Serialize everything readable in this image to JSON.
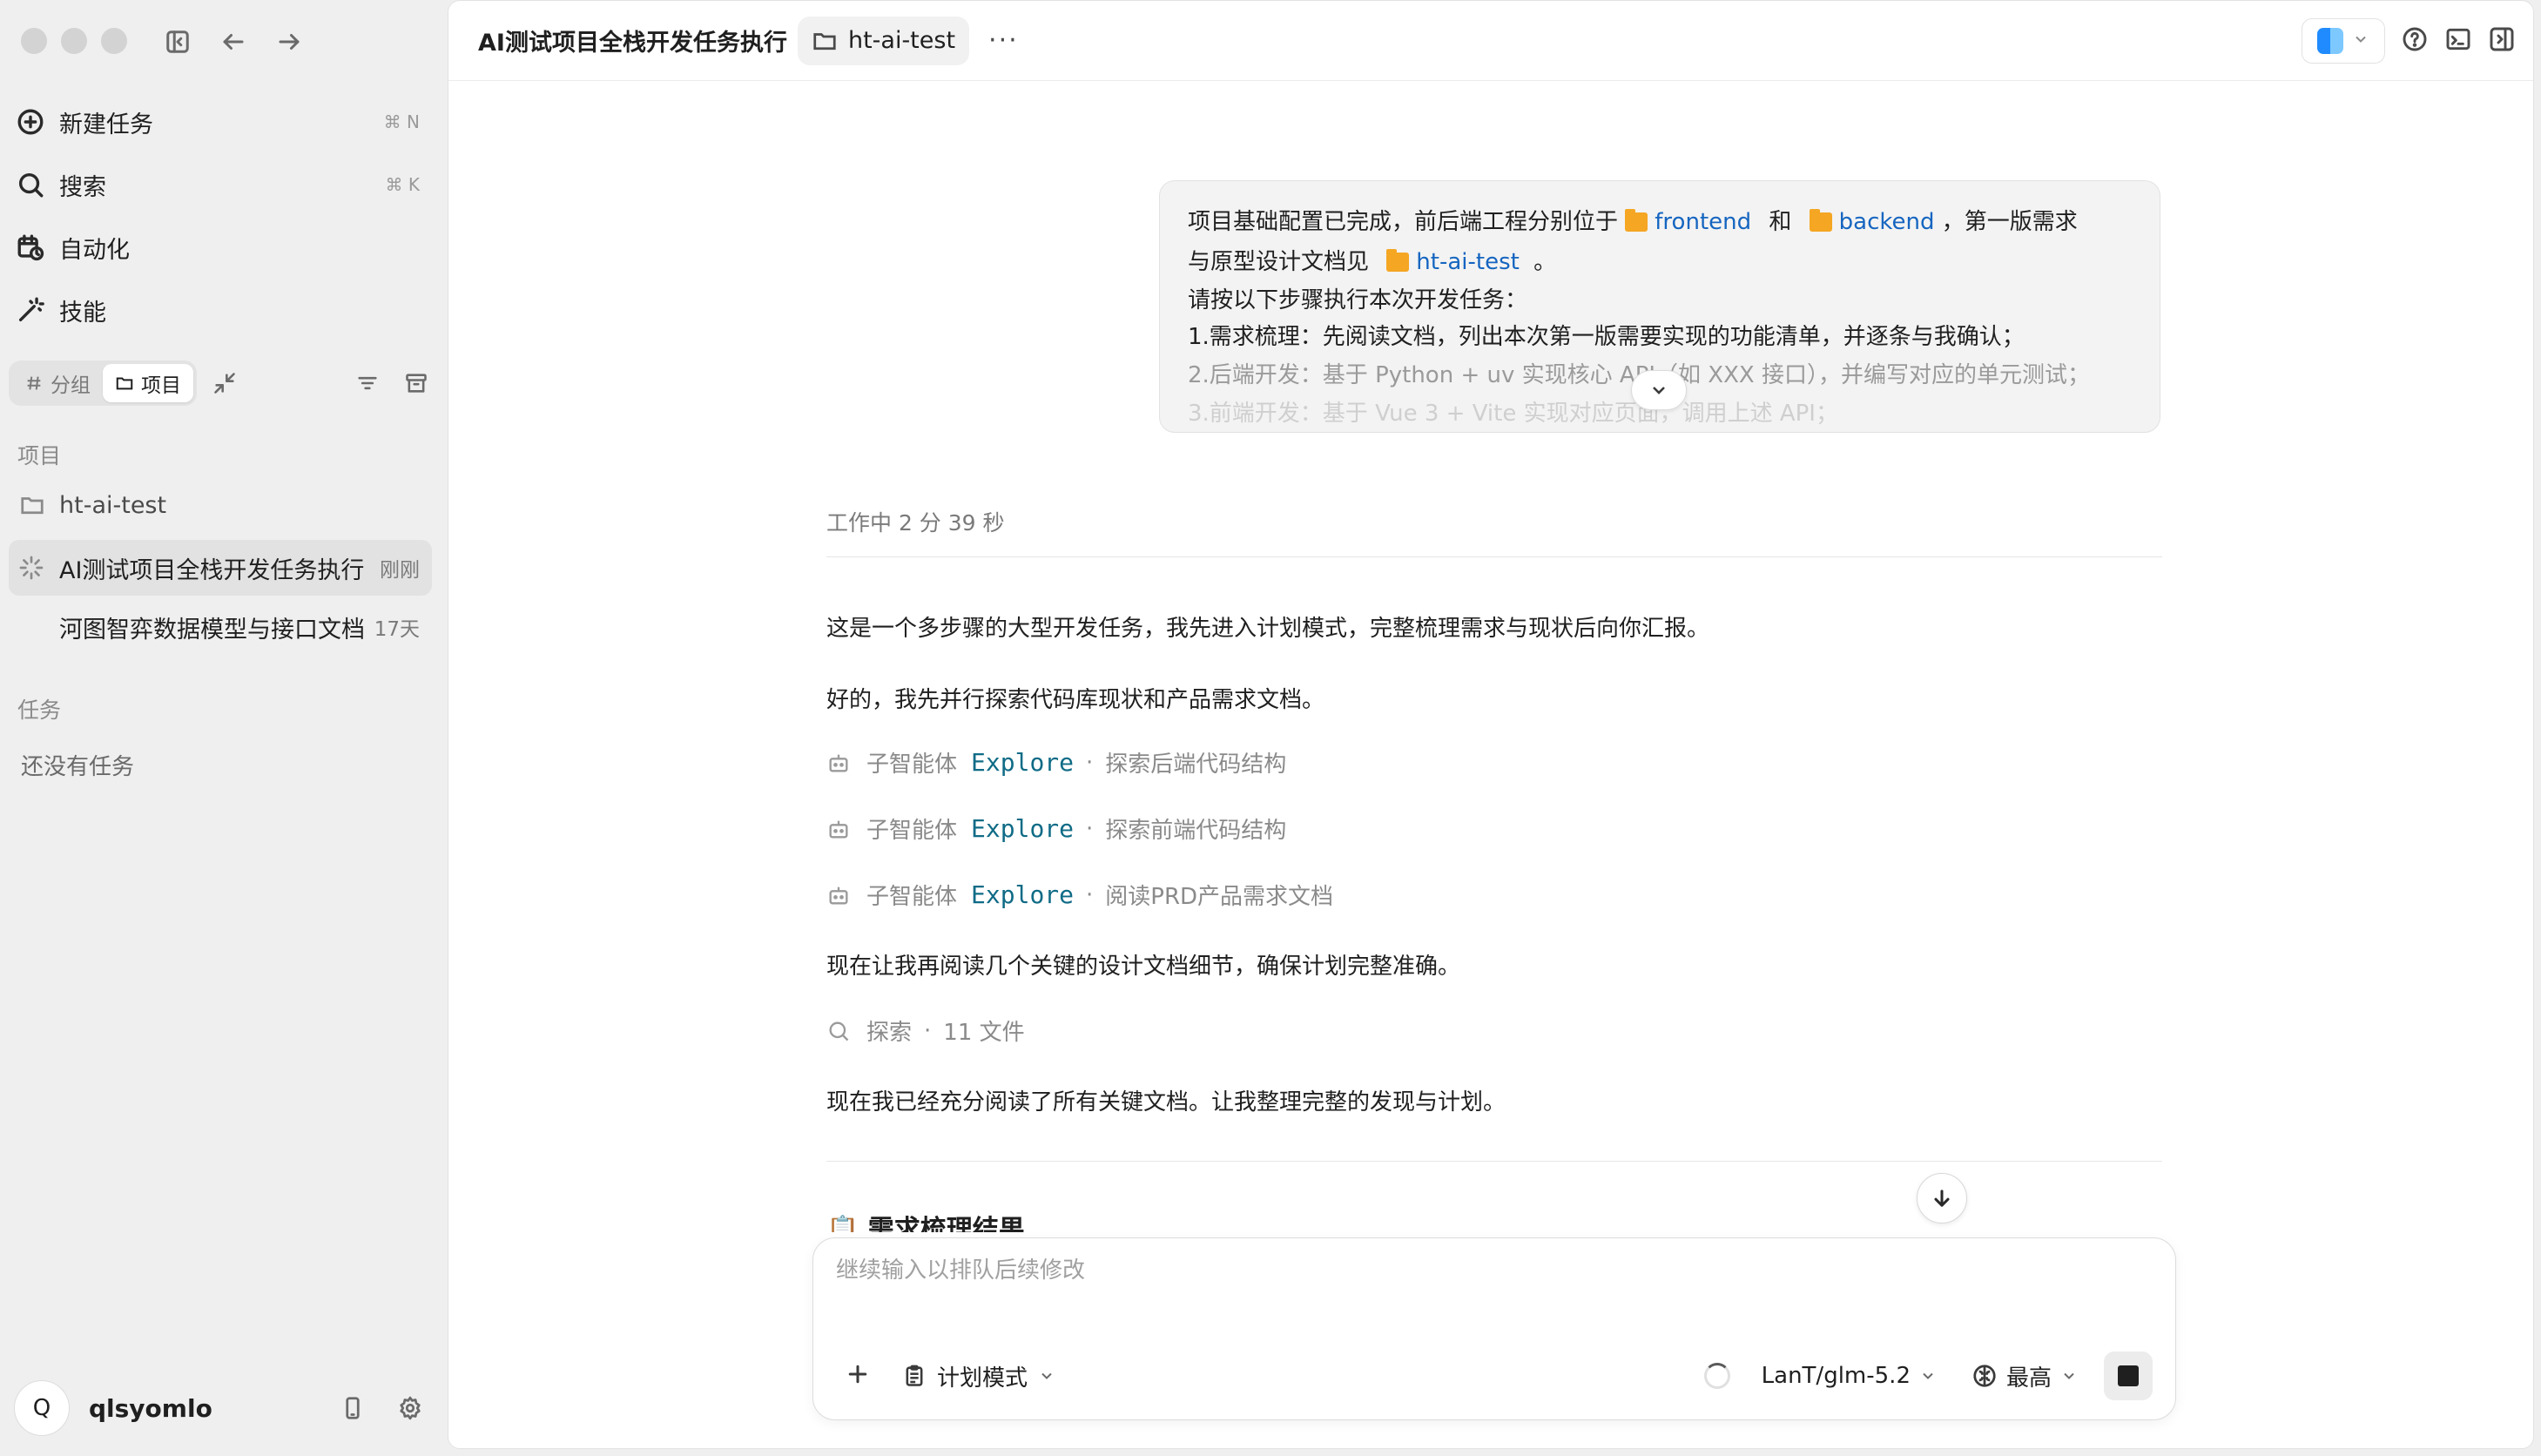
{
  "sidebar": {
    "nav": [
      {
        "label": "新建任务",
        "shortcut": "⌘ N",
        "icon": "plus-circle-icon"
      },
      {
        "label": "搜索",
        "shortcut": "⌘ K",
        "icon": "search-icon"
      },
      {
        "label": "自动化",
        "shortcut": "",
        "icon": "calendar-clock-icon"
      },
      {
        "label": "技能",
        "shortcut": "",
        "icon": "magic-wand-icon"
      }
    ],
    "filters": {
      "group_label": "分组",
      "project_label": "项目",
      "active": "项目"
    },
    "projects_title": "项目",
    "project_name": "ht-ai-test",
    "tasks": [
      {
        "name": "AI测试项目全栈开发任务执行",
        "time": "刚刚",
        "active": true
      },
      {
        "name": "河图智弈数据模型与接口文档",
        "time": "17天",
        "active": false
      }
    ],
    "tasks_section_title": "任务",
    "tasks_empty": "还没有任务",
    "user": {
      "avatar_letter": "Q",
      "name": "qlsyomlo"
    }
  },
  "topbar": {
    "title": "AI测试项目全栈开发任务执行",
    "folder": "ht-ai-test",
    "more": "···"
  },
  "message": {
    "line1_pre": "项目基础配置已完成，前后端工程分别位于",
    "frontend": "frontend",
    "and": "和",
    "backend": "backend",
    "line1_post": "，第一版需求",
    "line2_pre": "与原型设计文档见",
    "doc_folder": "ht-ai-test",
    "line2_post": "。",
    "line3": "请按以下步骤执行本次开发任务：",
    "line4": "1.需求梳理：先阅读文档，列出本次第一版需要实现的功能清单，并逐条与我确认；",
    "line5": "2.后端开发：基于 Python + uv 实现核心 API（如 XXX 接口），并编写对应的单元测试；",
    "line6": "3.前端开发：基于 Vue 3 + Vite 实现对应页面，调用上述 API；"
  },
  "conversation": {
    "working": "工作中 2 分 39 秒",
    "p1": "这是一个多步骤的大型开发任务，我先进入计划模式，完整梳理需求与现状后向你汇报。",
    "p2": "好的，我先并行探索代码库现状和产品需求文档。",
    "subagents": [
      {
        "prefix": "子智能体",
        "agent": "Explore",
        "task": "探索后端代码结构"
      },
      {
        "prefix": "子智能体",
        "agent": "Explore",
        "task": "探索前端代码结构"
      },
      {
        "prefix": "子智能体",
        "agent": "Explore",
        "task": "阅读PRD产品需求文档"
      }
    ],
    "p3": "现在让我再阅读几个关键的设计文档细节，确保计划完整准确。",
    "search": {
      "label": "探索",
      "count": "11 文件"
    },
    "p4": "现在我已经充分阅读了所有关键文档。让我整理完整的发现与计划。",
    "heading": "📋 需求梳理结果"
  },
  "composer": {
    "placeholder": "继续输入以排队后续修改",
    "mode": "计划模式",
    "model": "LanT/glm-5.2",
    "effort": "最高"
  }
}
